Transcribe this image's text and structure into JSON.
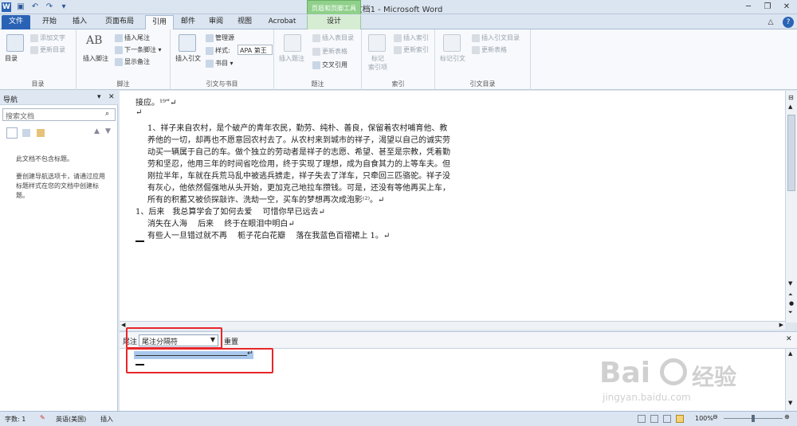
{
  "window": {
    "title": "文档1 - Microsoft Word",
    "context_title": "页眉和页脚工具"
  },
  "tabs": [
    "文件",
    "开始",
    "插入",
    "页面布局",
    "引用",
    "邮件",
    "审阅",
    "视图",
    "Acrobat",
    "设计"
  ],
  "ribbon": {
    "toc": {
      "big": "目录",
      "add_text": "添加文字",
      "update": "更新目录",
      "label": "目录"
    },
    "footnote": {
      "big": "插入脚注",
      "insert_endnote": "插入尾注",
      "next": "下一条脚注",
      "show": "显示备注",
      "label": "脚注",
      "ab": "AB"
    },
    "citation": {
      "big": "插入引文",
      "manage": "管理源",
      "style_label": "样式:",
      "style_value": "APA 第王",
      "bib": "书目",
      "label": "引文与书目"
    },
    "caption": {
      "big": "插入题注",
      "insert_table": "插入表目录",
      "update_table": "更新表格",
      "cross": "交叉引用",
      "label": "题注"
    },
    "index": {
      "big": "标记\n索引项",
      "insert": "插入索引",
      "update": "更新索引",
      "label": "索引"
    },
    "toa": {
      "big": "标记引文",
      "insert": "插入引文目录",
      "update": "更新表格",
      "label": "引文目录"
    }
  },
  "nav": {
    "title": "导航",
    "search_placeholder": "搜索文档",
    "msg1": "此文档不包含标题。",
    "msg2": "要创建导航选项卡，请通过应用标题样式在您的文档中创建标题。"
  },
  "doc": {
    "lines": [
      "接应。¹⁹”↵",
      "↵",
      "1、祥子来自农村，是个破产的青年农民，勤劳、纯朴、善良，保留着农村哺育他、教",
      "养他的一切，却再也不愿意回农村去了。从农村来到城市的祥子，渴望以自己的诚实劳",
      "动买一辆属于自己的车。做个独立的劳动者是祥子的志愿、希望、甚至是宗教，凭着勤",
      "劳和坚忍，他用三年的时间省吃俭用，终于实现了理想，成为自食其力的上等车夫。但",
      "刚拉半年，车就在兵荒马乱中被逃兵掳走，祥子失去了洋车，只牵回三匹骆驼。祥子没",
      "有灰心，他依然倔强地从头开始，更加克己地拉车攒钱。可是，还没有等他再买上车，",
      "所有的积蓄又被侦探敲诈、洗劫一空，买车的梦想再次成泡影⁽²⁾。↵",
      "1、后来　我总算学会了如何去爱　 可惜你早已远去↵",
      "消失在人海　 后来　 终于在眼泪中明白↵",
      "有些人一旦错过就不再　 栀子花白花瓣　 落在我蓝色百褶裙上 1。↵"
    ]
  },
  "notes": {
    "label": "尾注",
    "select_value": "尾注分隔符",
    "reset": "重置",
    "sep_mark": "↵"
  },
  "status": {
    "words": "字数: 1",
    "lang": "英语(美国)",
    "mode": "插入",
    "zoom": "100%"
  },
  "watermark": {
    "brand": "Bai",
    "brand2": "经验",
    "url": "jingyan.baidu.com"
  },
  "colors": {
    "accent": "#2a63b5",
    "ctx_green": "#8fd08a",
    "red": "#e8262a"
  }
}
